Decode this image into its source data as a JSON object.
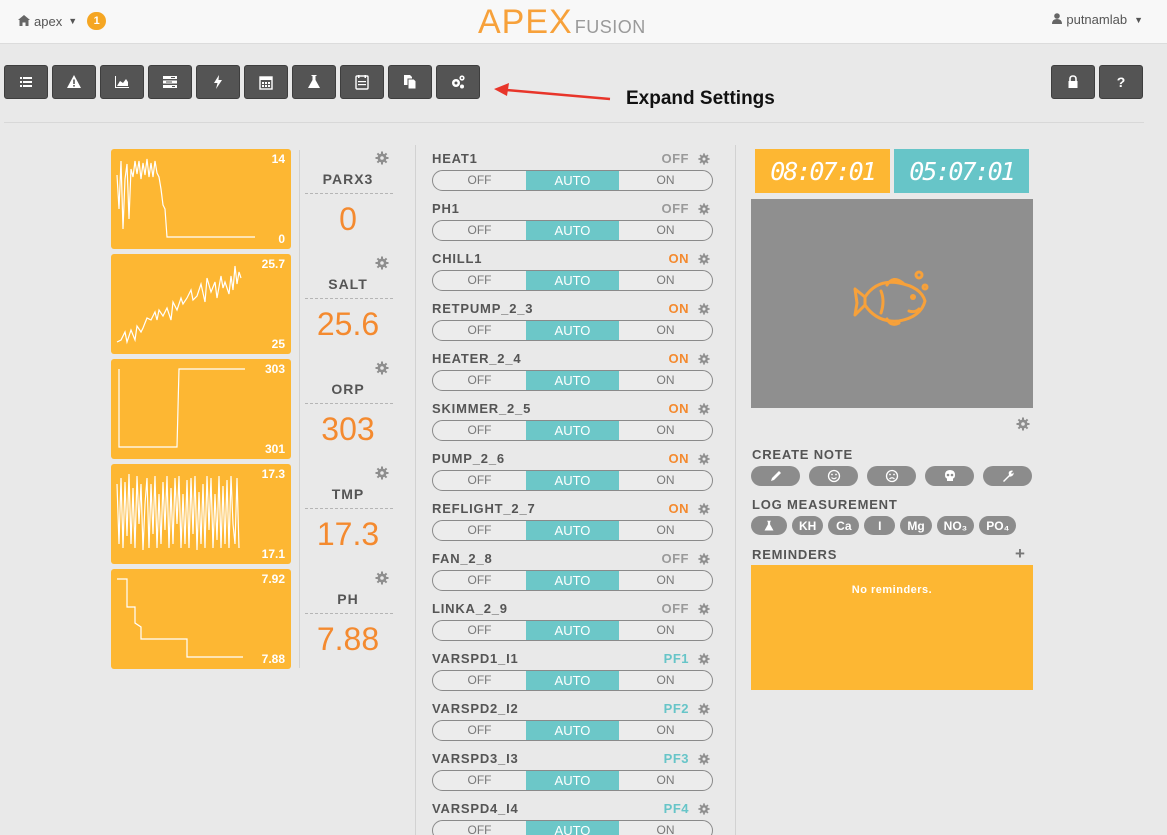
{
  "navbar": {
    "account": "apex",
    "badge_count": "1",
    "logo_main": "APEX",
    "logo_sub": "FUSION",
    "user": "putnamlab"
  },
  "toolbar": {
    "buttons": [
      "list-icon",
      "warning-icon",
      "area-chart-icon",
      "tasks-icon",
      "bolt-icon",
      "calendar-icon",
      "flask-icon",
      "calendar-check-icon",
      "copy-icon",
      "cogs-icon"
    ],
    "right_buttons": [
      "lock-icon",
      "question-icon"
    ],
    "help_label": "?"
  },
  "annotation": {
    "text": "Expand Settings",
    "arrow_color": "#e8352a"
  },
  "probes": [
    {
      "name": "PARX3",
      "value": "0",
      "max": "14",
      "min": "0"
    },
    {
      "name": "SALT",
      "value": "25.6",
      "max": "25.7",
      "min": "25"
    },
    {
      "name": "ORP",
      "value": "303",
      "max": "303",
      "min": "301"
    },
    {
      "name": "TMP",
      "value": "17.3",
      "max": "17.3",
      "min": "17.1"
    },
    {
      "name": "PH",
      "value": "7.88",
      "max": "7.92",
      "min": "7.88"
    }
  ],
  "outlets": [
    {
      "name": "HEAT1",
      "state": "OFF",
      "state_color": "#9a9a9a"
    },
    {
      "name": "PH1",
      "state": "OFF",
      "state_color": "#9a9a9a"
    },
    {
      "name": "CHILL1",
      "state": "ON",
      "state_color": "#f48a2f"
    },
    {
      "name": "RETPUMP_2_3",
      "state": "ON",
      "state_color": "#f48a2f"
    },
    {
      "name": "HEATER_2_4",
      "state": "ON",
      "state_color": "#f48a2f"
    },
    {
      "name": "SKIMMER_2_5",
      "state": "ON",
      "state_color": "#f48a2f"
    },
    {
      "name": "PUMP_2_6",
      "state": "ON",
      "state_color": "#f48a2f"
    },
    {
      "name": "REFLIGHT_2_7",
      "state": "ON",
      "state_color": "#f48a2f"
    },
    {
      "name": "FAN_2_8",
      "state": "OFF",
      "state_color": "#9a9a9a"
    },
    {
      "name": "LINKA_2_9",
      "state": "OFF",
      "state_color": "#9a9a9a"
    },
    {
      "name": "VARSPD1_I1",
      "state": "PF1",
      "state_color": "#67c5c8"
    },
    {
      "name": "VARSPD2_I2",
      "state": "PF2",
      "state_color": "#67c5c8"
    },
    {
      "name": "VARSPD3_I3",
      "state": "PF3",
      "state_color": "#67c5c8"
    },
    {
      "name": "VARSPD4_I4",
      "state": "PF4",
      "state_color": "#67c5c8"
    }
  ],
  "switch_labels": {
    "off": "OFF",
    "auto": "AUTO",
    "on": "ON",
    "selected": "AUTO"
  },
  "clocks": {
    "local": "08:07:01",
    "controller": "05:07:01"
  },
  "camera_icon": "fish-icon",
  "create_note": {
    "title": "CREATE NOTE",
    "buttons": [
      "pencil-icon",
      "smile-icon",
      "frown-icon",
      "skull-icon",
      "wrench-icon"
    ]
  },
  "log_measurement": {
    "title": "LOG MEASUREMENT",
    "items": [
      "flask-icon",
      "KH",
      "Ca",
      "I",
      "Mg",
      "NO₃",
      "PO₄"
    ]
  },
  "reminders": {
    "title": "REMINDERS",
    "add": "+",
    "empty_text": "No reminders."
  },
  "colors": {
    "accent_orange": "#fdb733",
    "value_orange": "#f48a2f",
    "teal": "#67c5c8",
    "toolbar_dark": "#545454"
  }
}
